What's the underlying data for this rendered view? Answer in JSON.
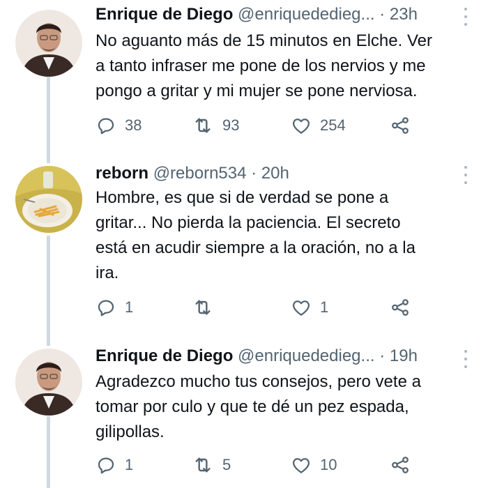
{
  "tweets": [
    {
      "name": "Enrique de Diego",
      "handle": "@enriquededieg...",
      "dot": "·",
      "time": "23h",
      "lines": [
        "No aguanto más de 15 minutos en Elche. Ver",
        "a tanto infraser me pone de los nervios y me",
        "pongo a gritar y mi mujer se pone nerviosa."
      ],
      "replies": "38",
      "retweets": "93",
      "likes": "254"
    },
    {
      "name": "reborn",
      "handle": "@reborn534",
      "dot": "·",
      "time": "20h",
      "lines": [
        "Hombre, es que si de verdad se pone a",
        "gritar... No pierda la paciencia. El secreto",
        "está en acudir siempre a la oración, no a la",
        "ira."
      ],
      "replies": "1",
      "retweets": "",
      "likes": "1"
    },
    {
      "name": "Enrique de Diego",
      "handle": "@enriquededieg...",
      "dot": "·",
      "time": "19h",
      "lines": [
        "Agradezco mucho tus consejos, pero vete a",
        "tomar por culo y que te dé un pez espada,",
        "gilipollas."
      ],
      "replies": "1",
      "retweets": "5",
      "likes": "10"
    }
  ],
  "icons": {
    "reply": "reply-icon",
    "retweet": "retweet-icon",
    "like": "heart-icon",
    "share": "share-icon",
    "more": "more-icon"
  },
  "colors": {
    "text": "#0f1419",
    "secondary": "#536471",
    "thread_line": "#cfd9de"
  }
}
